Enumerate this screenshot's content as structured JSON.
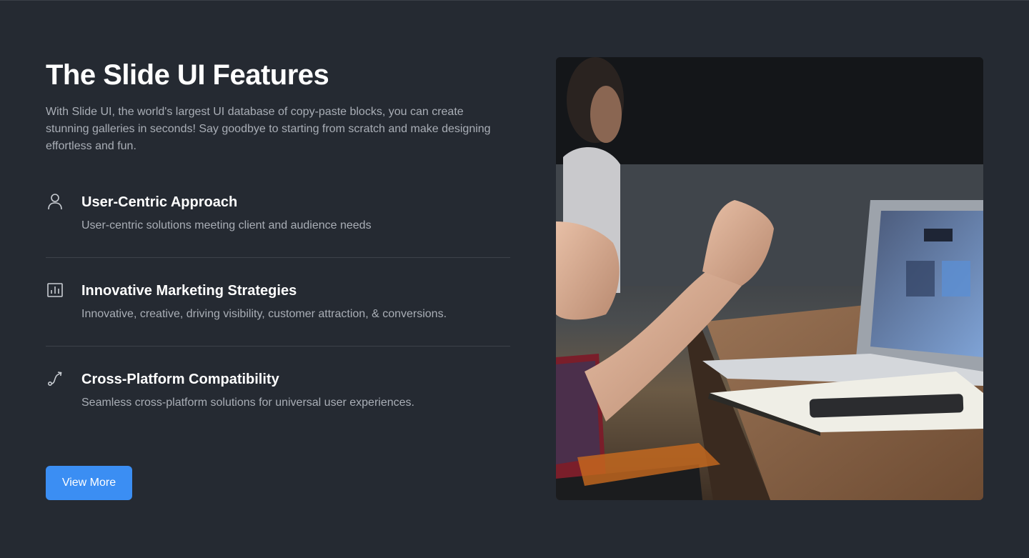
{
  "header": {
    "title": "The Slide UI Features",
    "description": "With Slide UI, the world's largest UI database of copy-paste blocks, you can create stunning galleries in seconds! Say goodbye to starting from scratch and make designing effortless and fun."
  },
  "features": [
    {
      "icon": "user-icon",
      "title": "User-Centric Approach",
      "text": "User-centric solutions meeting client and audience needs"
    },
    {
      "icon": "bar-chart-icon",
      "title": "Innovative Marketing Strategies",
      "text": "Innovative, creative, driving visibility, customer attraction, & conversions."
    },
    {
      "icon": "route-icon",
      "title": "Cross-Platform Compatibility",
      "text": "Seamless cross-platform solutions for universal user experiences."
    }
  ],
  "cta": {
    "label": "View More"
  },
  "colors": {
    "background": "#252a32",
    "accent": "#3b8ef3",
    "muted_text": "#a9aeb6"
  }
}
